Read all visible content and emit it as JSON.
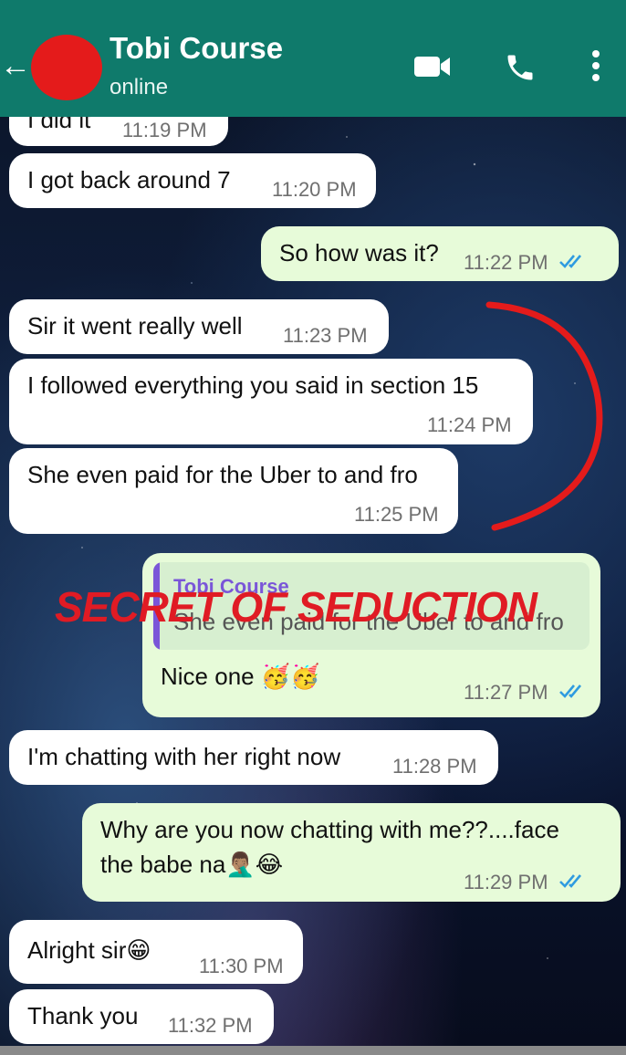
{
  "header": {
    "contact_name": "Tobi Course",
    "status": "online",
    "back_icon": "←",
    "accent_color": "#0f7a6b"
  },
  "messages": [
    {
      "direction": "incoming",
      "text": "I did it",
      "time": "11:19 PM"
    },
    {
      "direction": "incoming",
      "text": "I got back around 7",
      "time": "11:20 PM"
    },
    {
      "direction": "outgoing",
      "text": "So how was it?",
      "time": "11:22 PM",
      "read": true
    },
    {
      "direction": "incoming",
      "text": "Sir it went really well",
      "time": "11:23 PM"
    },
    {
      "direction": "incoming",
      "text": "I followed everything you said in section 15",
      "time": "11:24 PM"
    },
    {
      "direction": "incoming",
      "text": "She even paid for the Uber to and fro",
      "time": "11:25 PM"
    },
    {
      "direction": "outgoing",
      "text": "Nice one 🥳🥳",
      "time": "11:27 PM",
      "read": true,
      "reply_to": {
        "name": "Tobi Course",
        "text": "She even paid for the Uber to and fro"
      }
    },
    {
      "direction": "incoming",
      "text": "I'm chatting with her right now",
      "time": "11:28 PM"
    },
    {
      "direction": "outgoing",
      "text_line1": "Why are you now chatting with me??....face",
      "text_line2": "the babe na🤦🏽‍♂️😂",
      "time": "11:29 PM",
      "read": true
    },
    {
      "direction": "incoming",
      "text": "Alright sir😁",
      "time": "11:30 PM"
    },
    {
      "direction": "incoming",
      "text": "Thank you",
      "time": "11:32 PM"
    }
  ],
  "watermark": "SECRET OF SEDUCTION",
  "colors": {
    "incoming": "#ffffff",
    "outgoing": "#e7fbd9",
    "read_ticks": "#2f9be0",
    "annotation": "#e41b1b"
  }
}
